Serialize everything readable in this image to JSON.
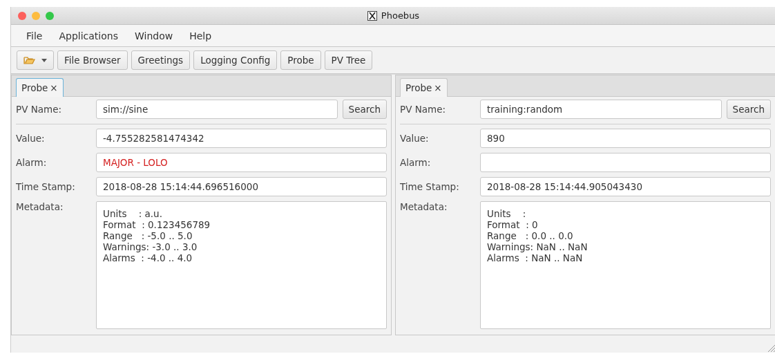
{
  "window": {
    "title": "Phoebus"
  },
  "menu": [
    "File",
    "Applications",
    "Window",
    "Help"
  ],
  "toolbar": {
    "buttons": [
      "File Browser",
      "Greetings",
      "Logging Config",
      "Probe",
      "PV Tree"
    ]
  },
  "panes": [
    {
      "tab": {
        "label": "Probe",
        "close": "×",
        "selected": true
      },
      "pv_name": {
        "label": "PV Name:",
        "value": "sim://sine"
      },
      "search": "Search",
      "fields": [
        {
          "label": "Value:",
          "value": "-4.755282581474342",
          "alarm": false
        },
        {
          "label": "Alarm:",
          "value": "MAJOR - LOLO",
          "alarm": true
        },
        {
          "label": "Time Stamp:",
          "value": "2018-08-28 15:14:44.696516000",
          "alarm": false
        }
      ],
      "metadata": {
        "label": "Metadata:",
        "lines": [
          "Units    : a.u.",
          "Format  : 0.123456789",
          "Range   : -5.0 .. 5.0",
          "Warnings: -3.0 .. 3.0",
          "Alarms  : -4.0 .. 4.0"
        ]
      }
    },
    {
      "tab": {
        "label": "Probe",
        "close": "×",
        "selected": false
      },
      "pv_name": {
        "label": "PV Name:",
        "value": "training:random"
      },
      "search": "Search",
      "fields": [
        {
          "label": "Value:",
          "value": "890",
          "alarm": false
        },
        {
          "label": "Alarm:"
        },
        {
          "label": "Time Stamp:",
          "value": "2018-08-28 15:14:44.905043430",
          "alarm": false
        }
      ],
      "metadata": {
        "label": "Metadata:",
        "lines": [
          "Units    :",
          "Format  : 0",
          "Range   : 0.0 .. 0.0",
          "Warnings: NaN .. NaN",
          "Alarms  : NaN .. NaN"
        ]
      }
    }
  ]
}
